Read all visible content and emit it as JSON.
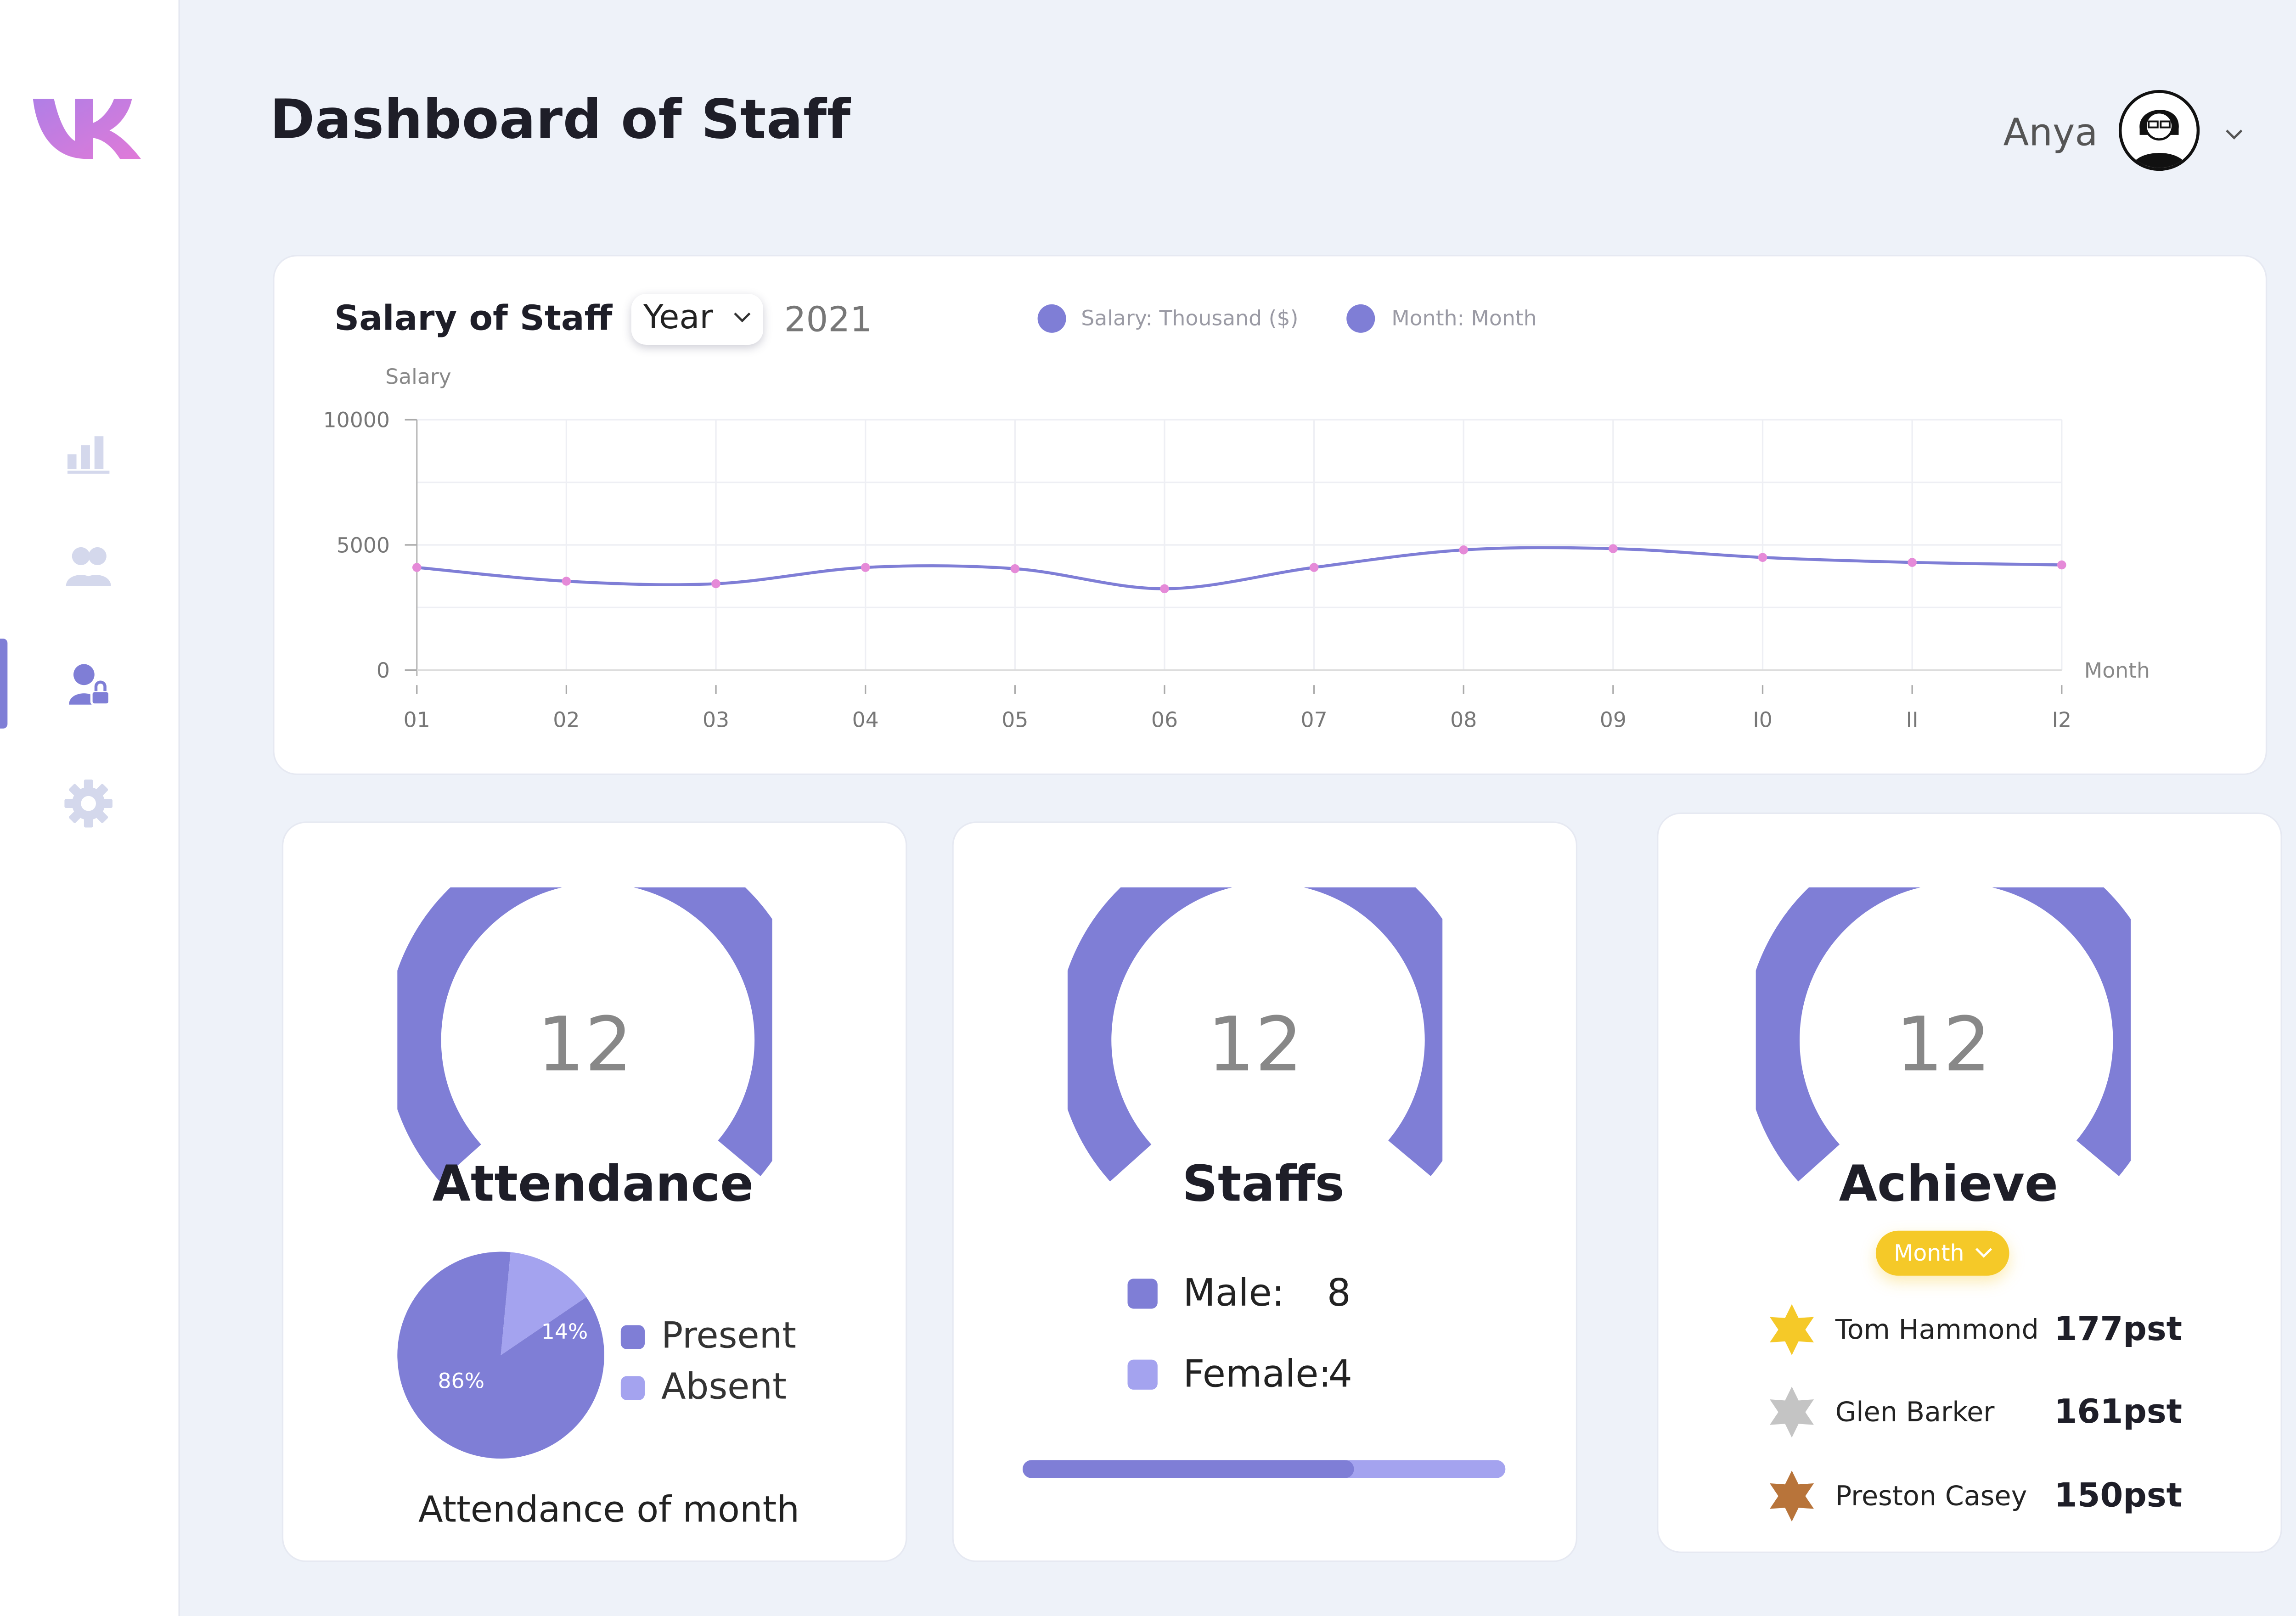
{
  "app": {
    "title": "Dashboard of Staff"
  },
  "user": {
    "name": "Anya"
  },
  "sidebar": {
    "items": [
      {
        "icon": "bar-chart-icon",
        "active": false
      },
      {
        "icon": "users-icon",
        "active": false
      },
      {
        "icon": "user-lock-icon",
        "active": true
      },
      {
        "icon": "gear-icon",
        "active": false
      }
    ]
  },
  "salary": {
    "title": "Salary of Staff",
    "period_select": "Year",
    "year": "2021",
    "legend": [
      "Salary: Thousand ($)",
      "Month: Month"
    ]
  },
  "chart_data": {
    "type": "line",
    "title": "Salary of Staff",
    "ylabel": "Salary",
    "xlabel": "Month",
    "categories": [
      "01",
      "02",
      "03",
      "04",
      "05",
      "06",
      "07",
      "08",
      "09",
      "10",
      "11",
      "12"
    ],
    "tick_labels": [
      "01",
      "02",
      "03",
      "04",
      "05",
      "06",
      "07",
      "08",
      "09",
      "I0",
      "II",
      "I2"
    ],
    "y_ticks": [
      "0",
      "5000",
      "10000"
    ],
    "ylim": [
      0,
      10000
    ],
    "series": [
      {
        "name": "Salary: Thousand ($)",
        "values": [
          4100,
          3550,
          3450,
          4100,
          4050,
          3250,
          4100,
          4800,
          4850,
          4500,
          4300,
          4200
        ]
      }
    ],
    "grid": true,
    "colors": {
      "line": "#7f7ed6",
      "point": "#e58ad8"
    }
  },
  "attendance": {
    "value": "12",
    "label": "Attendance",
    "pie": {
      "present_pct": "86%",
      "absent_pct": "14%",
      "present_value": 86,
      "absent_value": 14
    },
    "legend": {
      "present": "Present",
      "absent": "Absent"
    },
    "caption": "Attendance of month"
  },
  "staffs": {
    "value": "12",
    "label": "Staffs",
    "male_label": "Male:",
    "male_count": "8",
    "female_label": "Female:",
    "female_count": "4",
    "male_fraction": 0.6875
  },
  "achieve": {
    "value": "12",
    "label": "Achieve",
    "period": "Month",
    "leaders": [
      {
        "name": "Tom Hammond",
        "points": "177pst",
        "medal": "gold-star-icon"
      },
      {
        "name": "Glen Barker",
        "points": "161pst",
        "medal": "silver-star-icon"
      },
      {
        "name": "Preston Casey",
        "points": "150pst",
        "medal": "bronze-star-icon"
      }
    ]
  },
  "colors": {
    "accent": "#7f7ed6",
    "accent_light": "#a4a3ef",
    "gold": "#f5c928",
    "silver": "#c4c4c4",
    "bronze": "#b8743a",
    "background": "#eef2f9"
  }
}
